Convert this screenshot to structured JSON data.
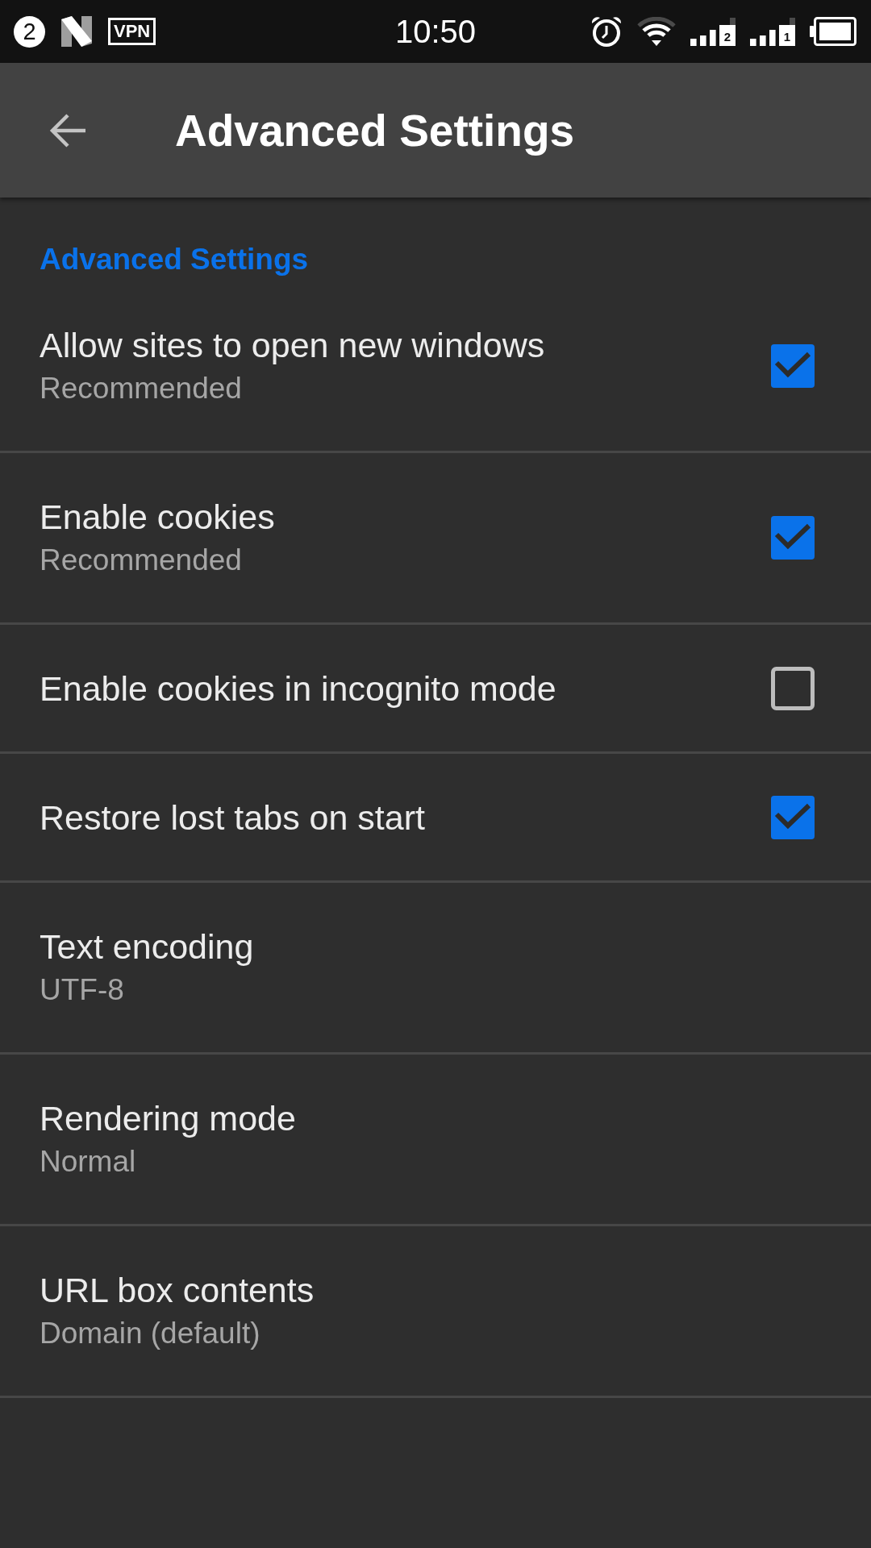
{
  "status_bar": {
    "notification_count": "2",
    "vpn": "VPN",
    "time": "10:50",
    "sim_slots": [
      "2",
      "1"
    ]
  },
  "toolbar": {
    "title": "Advanced Settings"
  },
  "section": {
    "title": "Advanced Settings"
  },
  "settings": [
    {
      "kind": "checkbox",
      "title": "Allow sites to open new windows",
      "summary": "Recommended",
      "checked": true
    },
    {
      "kind": "checkbox",
      "title": "Enable cookies",
      "summary": "Recommended",
      "checked": true
    },
    {
      "kind": "checkbox",
      "title": "Enable cookies in incognito mode",
      "checked": false
    },
    {
      "kind": "checkbox",
      "title": "Restore lost tabs on start",
      "checked": true
    },
    {
      "kind": "value",
      "title": "Text encoding",
      "summary": "UTF-8"
    },
    {
      "kind": "value",
      "title": "Rendering mode",
      "summary": "Normal"
    },
    {
      "kind": "value",
      "title": "URL box contents",
      "summary": "Domain (default)"
    }
  ]
}
